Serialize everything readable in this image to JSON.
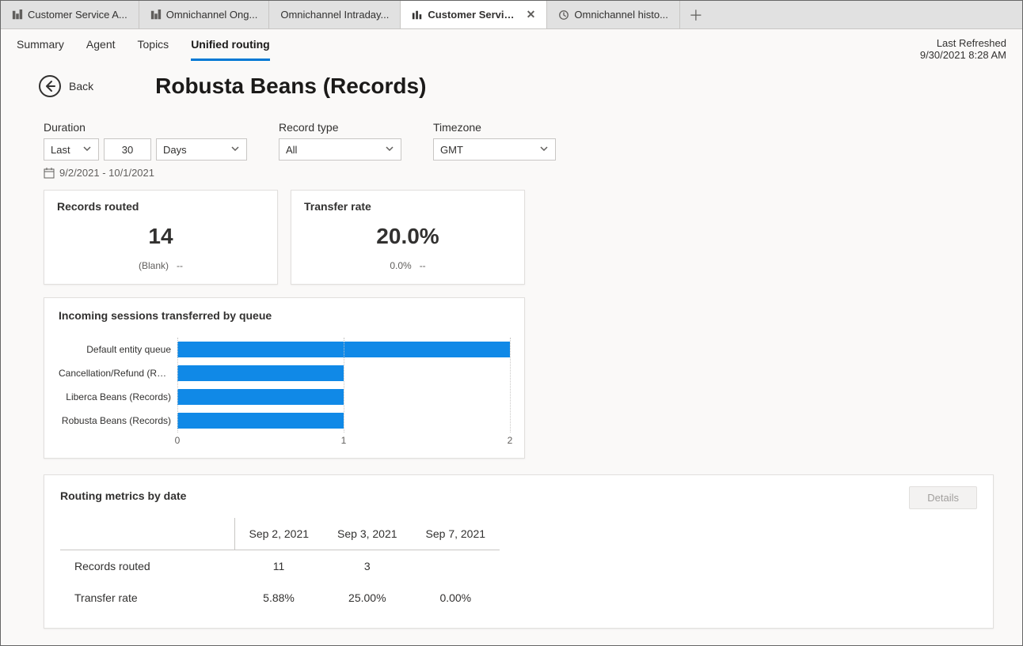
{
  "tabs": [
    {
      "label": "Customer Service A...",
      "active": false,
      "closable": false
    },
    {
      "label": "Omnichannel Ong...",
      "active": false,
      "closable": false
    },
    {
      "label": "Omnichannel Intraday...",
      "active": false,
      "closable": false
    },
    {
      "label": "Customer Service historic...",
      "active": true,
      "closable": true
    },
    {
      "label": "Omnichannel histo...",
      "active": false,
      "closable": false
    }
  ],
  "nav": {
    "items": [
      "Summary",
      "Agent",
      "Topics",
      "Unified routing"
    ],
    "active": "Unified routing"
  },
  "refreshed": {
    "label": "Last Refreshed",
    "value": "9/30/2021 8:28 AM"
  },
  "header": {
    "back_label": "Back",
    "page_title": "Robusta Beans (Records)"
  },
  "filters": {
    "duration": {
      "label": "Duration",
      "mode": "Last",
      "count": "30",
      "unit": "Days"
    },
    "record_type": {
      "label": "Record type",
      "value": "All"
    },
    "timezone": {
      "label": "Timezone",
      "value": "GMT"
    },
    "date_range": "9/2/2021 - 10/1/2021"
  },
  "kpis": {
    "records_routed": {
      "title": "Records routed",
      "value": "14",
      "sub_label": "(Blank)",
      "sub_value": "--"
    },
    "transfer_rate": {
      "title": "Transfer rate",
      "value": "20.0%",
      "sub_label": "0.0%",
      "sub_value": "--"
    }
  },
  "chart_data": {
    "type": "bar",
    "title": "Incoming sessions transferred by queue",
    "orientation": "horizontal",
    "xlabel": "",
    "ylabel": "",
    "xlim": [
      0,
      2
    ],
    "xticks": [
      0,
      1,
      2
    ],
    "categories": [
      "Default entity queue",
      "Cancellation/Refund (Rec...",
      "Liberca Beans (Records)",
      "Robusta Beans (Records)"
    ],
    "values": [
      2,
      1,
      1,
      1
    ]
  },
  "metrics_table": {
    "title": "Routing metrics by date",
    "details_label": "Details",
    "columns": [
      "Sep 2, 2021",
      "Sep 3, 2021",
      "Sep 7, 2021"
    ],
    "rows": [
      {
        "label": "Records routed",
        "values": [
          "11",
          "3",
          ""
        ]
      },
      {
        "label": "Transfer rate",
        "values": [
          "5.88%",
          "25.00%",
          "0.00%"
        ]
      }
    ]
  }
}
